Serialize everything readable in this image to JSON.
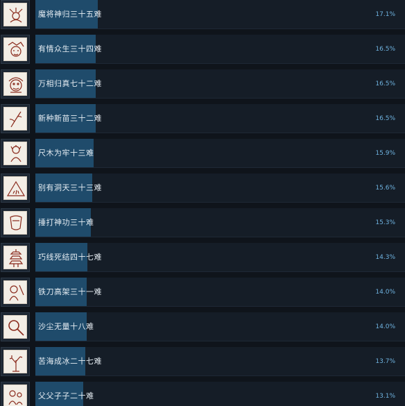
{
  "achievements": [
    {
      "name": "魔将神归三十五难",
      "percent": "17.1%",
      "fill": 0.171,
      "icon": "demon-general-icon"
    },
    {
      "name": "有情众生三十四难",
      "percent": "16.5%",
      "fill": 0.165,
      "icon": "sentient-beast-icon"
    },
    {
      "name": "万相归真七十二难",
      "percent": "16.5%",
      "fill": 0.165,
      "icon": "monkey-king-icon"
    },
    {
      "name": "新种新苗三十二难",
      "percent": "16.5%",
      "fill": 0.165,
      "icon": "sprout-icon"
    },
    {
      "name": "尺木为牢十三难",
      "percent": "15.9%",
      "fill": 0.159,
      "icon": "caged-figure-icon"
    },
    {
      "name": "别有洞天三十三难",
      "percent": "15.6%",
      "fill": 0.156,
      "icon": "cave-icon"
    },
    {
      "name": "捶打神功三十难",
      "percent": "15.3%",
      "fill": 0.153,
      "icon": "forge-icon"
    },
    {
      "name": "巧线死结四十七难",
      "percent": "14.3%",
      "fill": 0.143,
      "icon": "pagoda-icon"
    },
    {
      "name": "铁刀高架三十一难",
      "percent": "14.0%",
      "fill": 0.14,
      "icon": "iron-blade-icon"
    },
    {
      "name": "沙尘无量十八难",
      "percent": "14.0%",
      "fill": 0.14,
      "icon": "magnifier-icon"
    },
    {
      "name": "苦海成冰二十七难",
      "percent": "13.7%",
      "fill": 0.137,
      "icon": "frozen-tree-icon"
    },
    {
      "name": "父父子子二十难",
      "percent": "13.1%",
      "fill": 0.131,
      "icon": "father-son-icon"
    }
  ]
}
